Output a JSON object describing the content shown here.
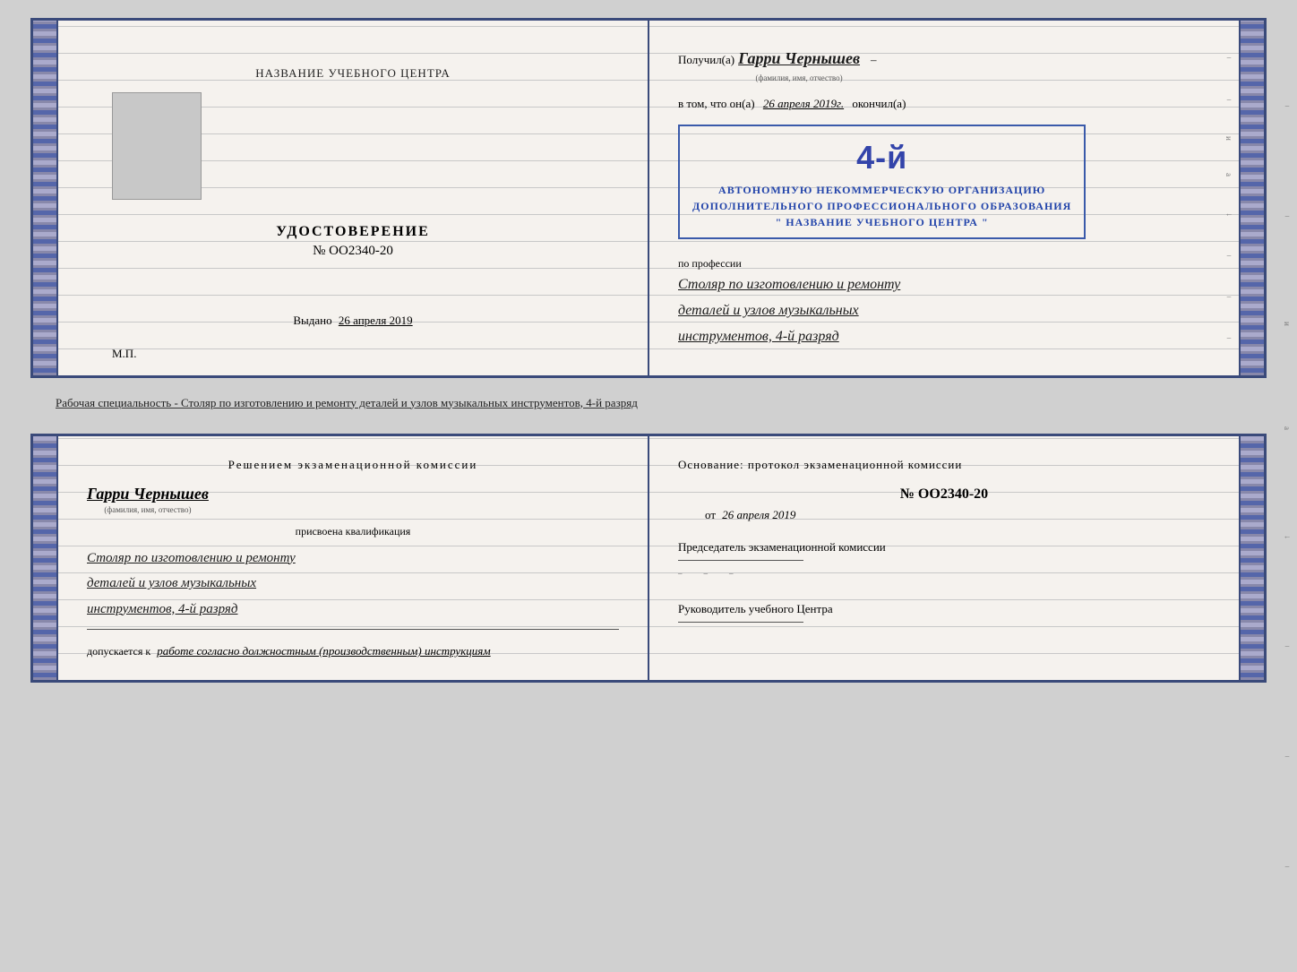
{
  "page": {
    "background_color": "#d0d0d0"
  },
  "top_doc": {
    "left": {
      "center_title": "НАЗВАНИЕ УЧЕБНОГО ЦЕНТРА",
      "certificate_label": "УДОСТОВЕРЕНИЕ",
      "certificate_number": "№ OO2340-20",
      "issued_label": "Выдано",
      "issued_date": "26 апреля 2019",
      "mp_label": "М.П."
    },
    "right": {
      "received_label": "Получил(а)",
      "recipient_name": "Гарри Чернышев",
      "fio_hint": "(фамилия, имя, отчество)",
      "in_that_label": "в том, что он(а)",
      "date_handwritten": "26 апреля 2019г.",
      "finished_label": "окончил(а)",
      "stamp_line1": "АВТОНОМНУЮ НЕКОММЕРЧЕСКУЮ ОРГАНИЗАЦИЮ",
      "stamp_line2": "ДОПОЛНИТЕЛЬНОГО ПРОФЕССИОНАЛЬНОГО ОБРАЗОВАНИЯ",
      "stamp_line3": "\" НАЗВАНИЕ УЧЕБНОГО ЦЕНТРА \"",
      "stamp_grade": "4-й",
      "profession_label": "по профессии",
      "profession_line1": "Столяр по изготовлению и ремонту",
      "profession_line2": "деталей и узлов музыкальных",
      "profession_line3": "инструментов, 4-й разряд"
    }
  },
  "caption": {
    "text": "Рабочая специальность - Столяр по изготовлению и ремонту деталей и узлов музыкальных инструментов, 4-й разряд"
  },
  "bottom_doc": {
    "left": {
      "decision_title": "Решением  экзаменационной  комиссии",
      "name": "Гарри Чернышев",
      "fio_hint": "(фамилия, имя, отчество)",
      "assigned_label": "присвоена квалификация",
      "profession_line1": "Столяр по изготовлению и ремонту",
      "profession_line2": "деталей и узлов музыкальных",
      "profession_line3": "инструментов, 4-й разряд",
      "allowed_label": "допускается к",
      "allowed_hw": "работе согласно должностным (производственным) инструкциям"
    },
    "right": {
      "basis_title": "Основание:  протокол  экзаменационной  комиссии",
      "protocol_number": "№  OO2340-20",
      "date_prefix": "от",
      "date_value": "26 апреля 2019",
      "chairman_title": "Председатель экзаменационной комиссии",
      "director_title": "Руководитель учебного Центра"
    }
  }
}
